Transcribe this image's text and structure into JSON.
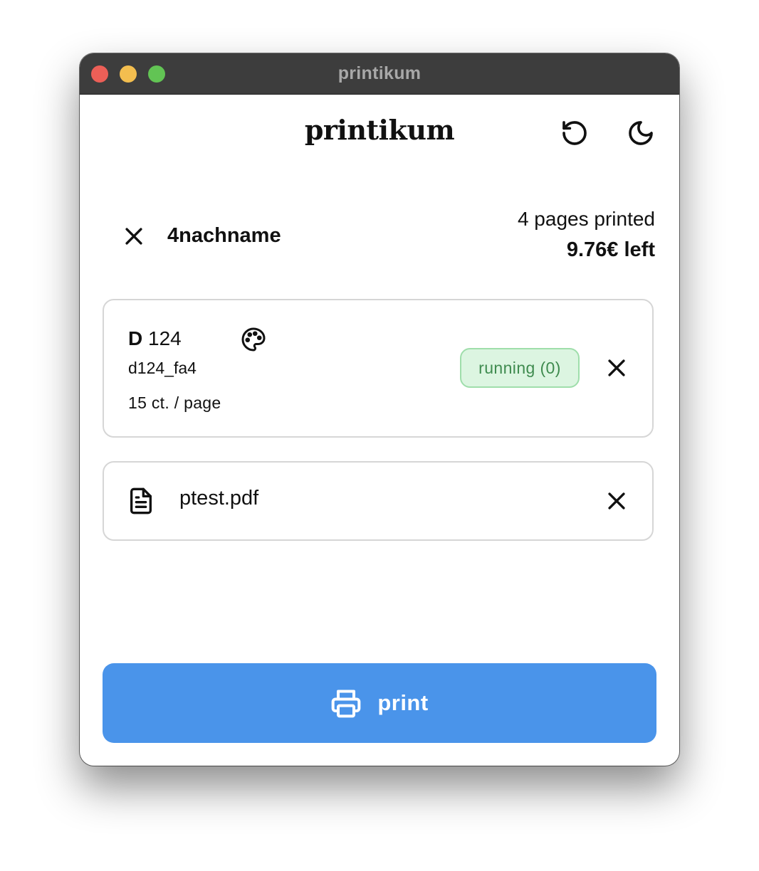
{
  "window": {
    "title": "printikum"
  },
  "header": {
    "logo": "printikum",
    "reset_icon": "rotate-ccw-icon",
    "theme_icon": "moon-icon"
  },
  "user": {
    "name": "4nachname",
    "pages_printed": "4 pages printed",
    "balance": "9.76€ left"
  },
  "printer": {
    "building": "D",
    "room": "124",
    "id": "d124_fa4",
    "price": "15 ct. / page",
    "status": "running (0)",
    "color_icon": "palette-icon"
  },
  "file": {
    "name": "ptest.pdf",
    "icon": "file-text-icon"
  },
  "print_button": {
    "label": "print",
    "icon": "printer-icon"
  },
  "colors": {
    "accent": "#4a94ea",
    "status_bg": "#dcf5e1",
    "status_border": "#9fdeab",
    "status_text": "#3f8b4f",
    "titlebar": "#3d3d3d"
  }
}
